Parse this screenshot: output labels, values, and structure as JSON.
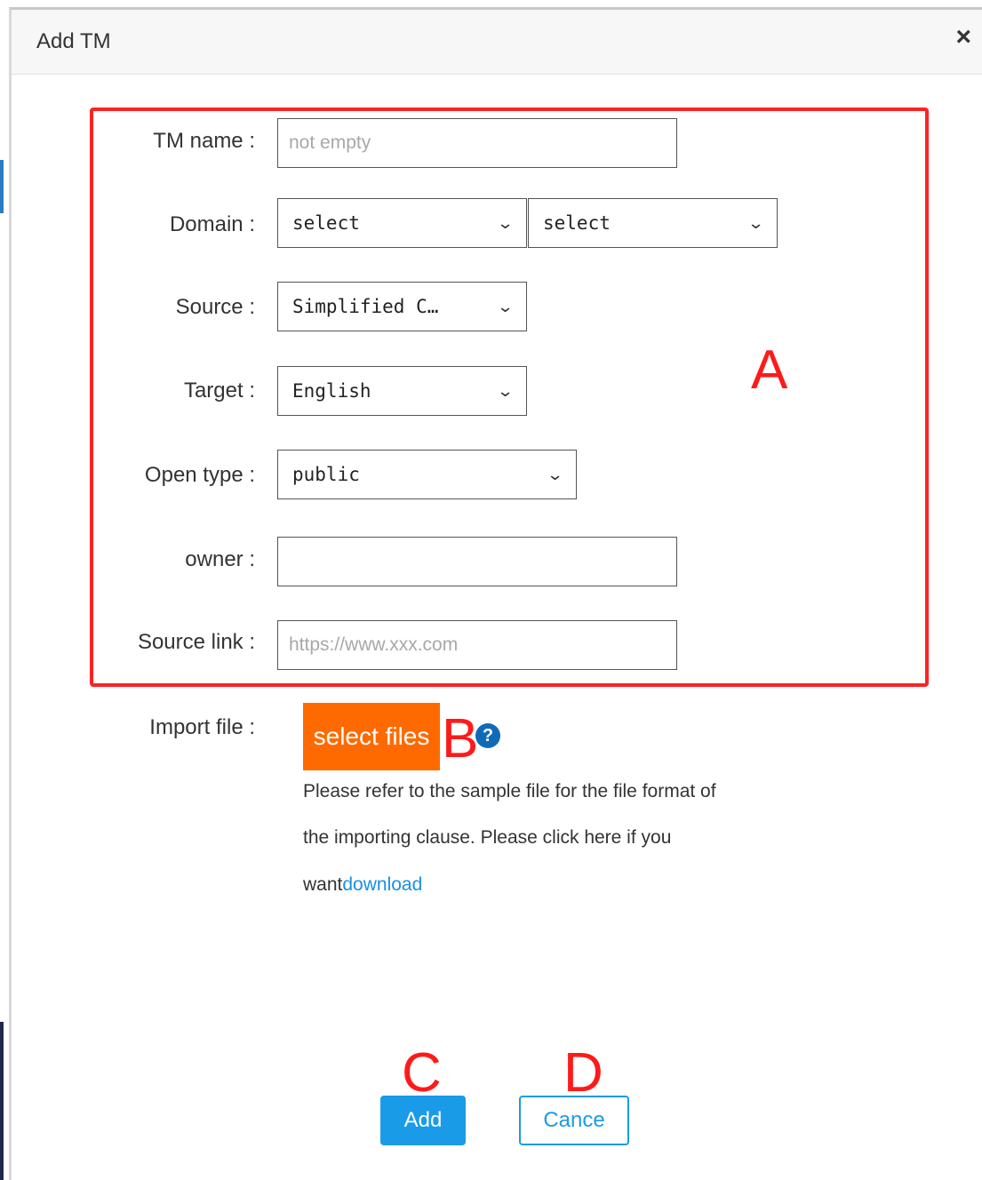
{
  "dialog": {
    "title": "Add TM",
    "close_glyph": "×"
  },
  "form": {
    "tm_name": {
      "label": "TM name :",
      "placeholder": "not empty"
    },
    "domain": {
      "label": "Domain :",
      "select1": "select",
      "select2": "select"
    },
    "source": {
      "label": "Source :",
      "value": "Simplified C…"
    },
    "target": {
      "label": "Target :",
      "value": "English"
    },
    "open_type": {
      "label": "Open type :",
      "value": "public"
    },
    "owner": {
      "label": "owner :",
      "value": ""
    },
    "source_link": {
      "label": "Source link :",
      "placeholder": "https://www.xxx.com"
    }
  },
  "import": {
    "label": "Import file :",
    "button": "select files",
    "help_glyph": "?",
    "note_line1": "Please refer to the sample file for the file format of",
    "note_line2": "the importing clause. Please click here if you",
    "note_line3_prefix": "want",
    "download_link": "download"
  },
  "actions": {
    "add": "Add",
    "cancel": "Cance"
  },
  "annotations": {
    "a": "A",
    "b": "B",
    "c": "C",
    "d": "D"
  },
  "colors": {
    "highlight": "#ff2222",
    "primary": "#1a9be8",
    "orange": "#ff6a00",
    "link": "#1a8fe3"
  },
  "icons": {
    "close": "close-icon",
    "dropdown": "chevron-down-icon",
    "help": "help-icon"
  }
}
